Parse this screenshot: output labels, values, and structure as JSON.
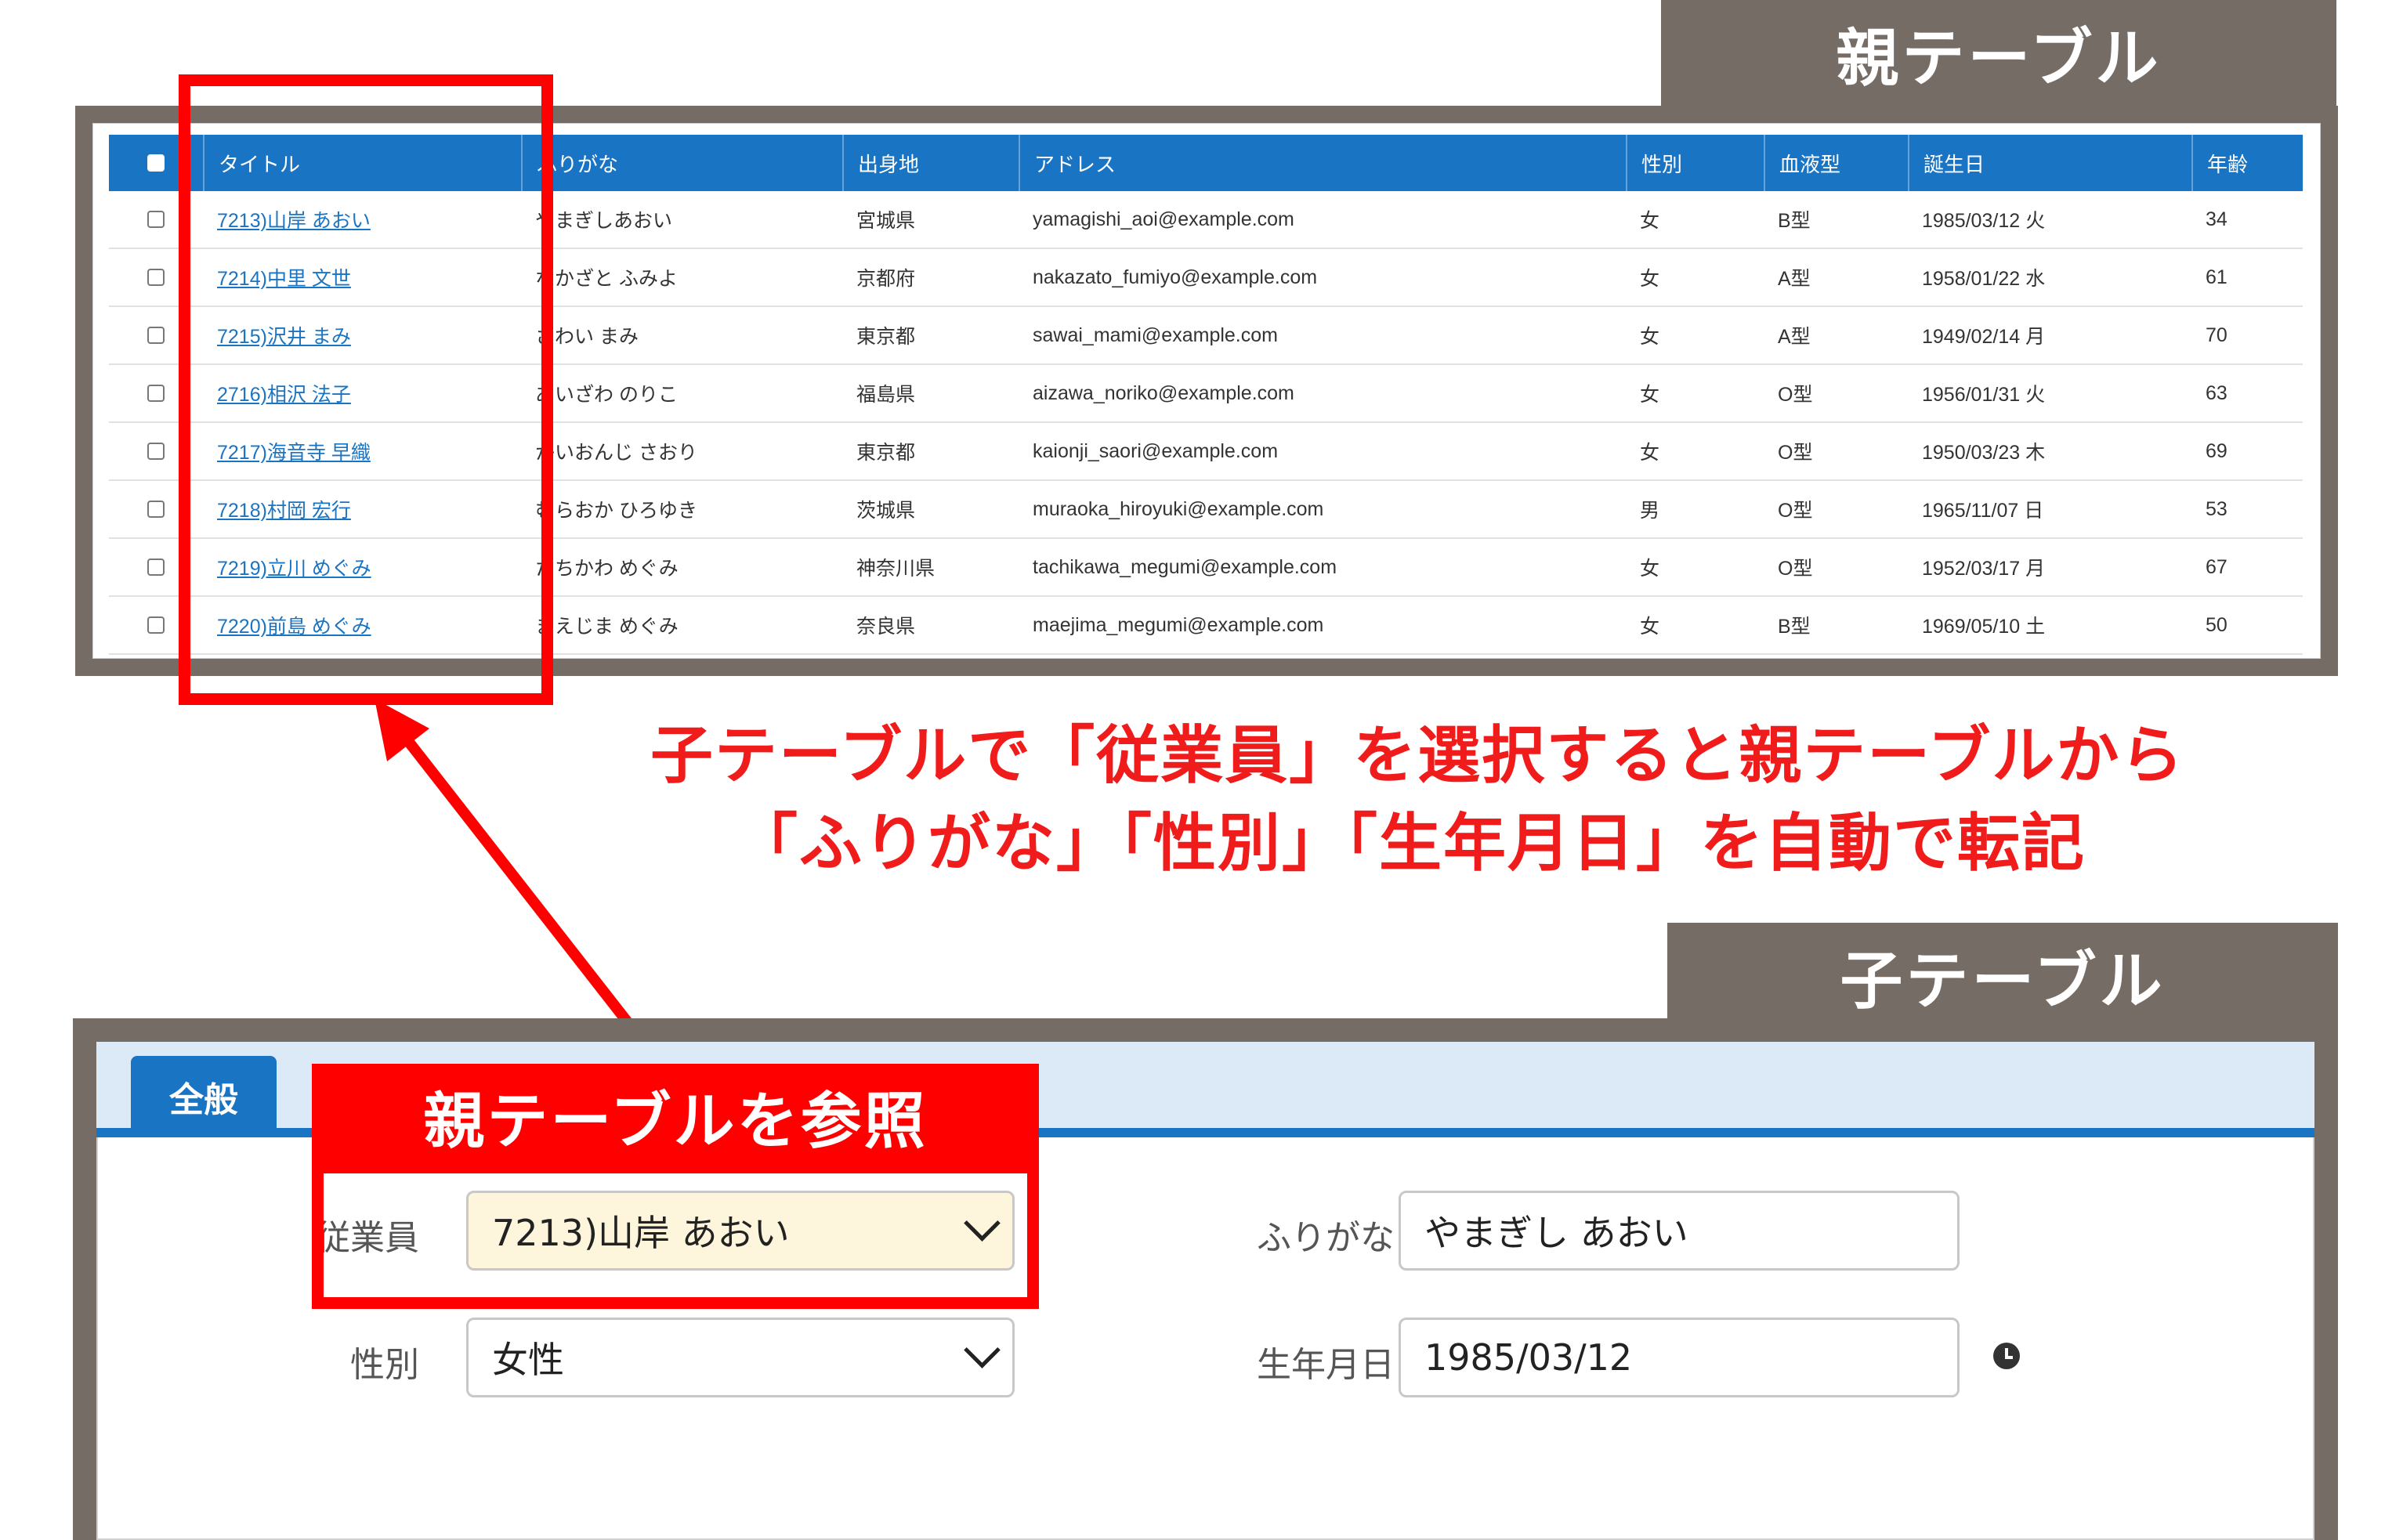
{
  "parent_label": "親テーブル",
  "child_label": "子テーブル",
  "table": {
    "headers": [
      "タイトル",
      "ふりがな",
      "出身地",
      "アドレス",
      "性別",
      "血液型",
      "誕生日",
      "年齢"
    ],
    "rows": [
      {
        "title": "7213)山岸 あおい",
        "furigana": "やまぎしあおい",
        "origin": "宮城県",
        "email": "yamagishi_aoi@example.com",
        "gender": "女",
        "blood": "B型",
        "birthday": "1985/03/12 火",
        "age": "34"
      },
      {
        "title": "7214)中里 文世",
        "furigana": "なかざと ふみよ",
        "origin": "京都府",
        "email": "nakazato_fumiyo@example.com",
        "gender": "女",
        "blood": "A型",
        "birthday": "1958/01/22 水",
        "age": "61"
      },
      {
        "title": "7215)沢井 まみ",
        "furigana": "さわい まみ",
        "origin": "東京都",
        "email": "sawai_mami@example.com",
        "gender": "女",
        "blood": "A型",
        "birthday": "1949/02/14 月",
        "age": "70"
      },
      {
        "title": "2716)相沢 法子",
        "furigana": "あいざわ のりこ",
        "origin": "福島県",
        "email": "aizawa_noriko@example.com",
        "gender": "女",
        "blood": "O型",
        "birthday": "1956/01/31 火",
        "age": "63"
      },
      {
        "title": "7217)海音寺 早織",
        "furigana": "かいおんじ さおり",
        "origin": "東京都",
        "email": "kaionji_saori@example.com",
        "gender": "女",
        "blood": "O型",
        "birthday": "1950/03/23 木",
        "age": "69"
      },
      {
        "title": "7218)村岡 宏行",
        "furigana": "むらおか ひろゆき",
        "origin": "茨城県",
        "email": "muraoka_hiroyuki@example.com",
        "gender": "男",
        "blood": "O型",
        "birthday": "1965/11/07 日",
        "age": "53"
      },
      {
        "title": "7219)立川 めぐみ",
        "furigana": "たちかわ めぐみ",
        "origin": "神奈川県",
        "email": "tachikawa_megumi@example.com",
        "gender": "女",
        "blood": "O型",
        "birthday": "1952/03/17 月",
        "age": "67"
      },
      {
        "title": "7220)前島 めぐみ",
        "furigana": "まえじま めぐみ",
        "origin": "奈良県",
        "email": "maejima_megumi@example.com",
        "gender": "女",
        "blood": "B型",
        "birthday": "1969/05/10 土",
        "age": "50"
      }
    ]
  },
  "caption": {
    "line1": "子テーブルで「従業員」を選択すると親テーブルから",
    "line2": "「ふりがな」「性別」「生年月日」を自動で転記"
  },
  "reference_banner": "親テーブルを参照",
  "form": {
    "tab": "全般",
    "employee_label": "従業員",
    "employee_value": "7213)山岸 あおい",
    "gender_label": "性別",
    "gender_value": "女性",
    "furigana_label": "ふりがな",
    "furigana_value": "やまぎし あおい",
    "birthdate_label": "生年月日",
    "birthdate_value": "1985/03/12"
  },
  "colors": {
    "accent_blue": "#1a74c4",
    "frame_gray": "#756c66",
    "highlight_red": "#ff0000",
    "caption_red": "#f01b1b"
  },
  "icons": [
    "checkbox-icon",
    "chevron-down-icon",
    "clock-icon",
    "arrow-icon"
  ]
}
